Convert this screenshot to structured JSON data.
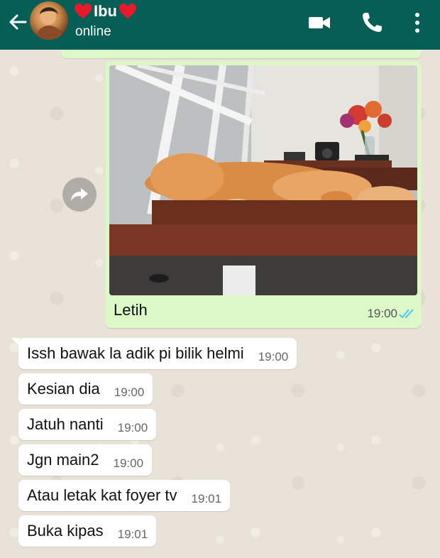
{
  "header": {
    "contact_name": "Ibu",
    "status": "online"
  },
  "image_message": {
    "caption": "Letih",
    "time": "19:00"
  },
  "messages": [
    {
      "text": "Issh bawak la adik pi bilik helmi",
      "time": "19:00"
    },
    {
      "text": "Kesian dia",
      "time": "19:00"
    },
    {
      "text": "Jatuh nanti",
      "time": "19:00"
    },
    {
      "text": "Jgn main2",
      "time": "19:00"
    },
    {
      "text": "Atau letak kat foyer tv",
      "time": "19:01"
    },
    {
      "text": "Buka kipas",
      "time": "19:01"
    }
  ],
  "colors": {
    "header_bg": "#075e54",
    "outgoing_bubble": "#dcf8c6",
    "incoming_bubble": "#ffffff",
    "read_ticks": "#4fc3f7",
    "heart": "#e8192c"
  },
  "icons": [
    "back-arrow-icon",
    "heart-icon",
    "video-call-icon",
    "phone-icon",
    "more-options-icon",
    "forward-icon",
    "double-check-icon"
  ]
}
